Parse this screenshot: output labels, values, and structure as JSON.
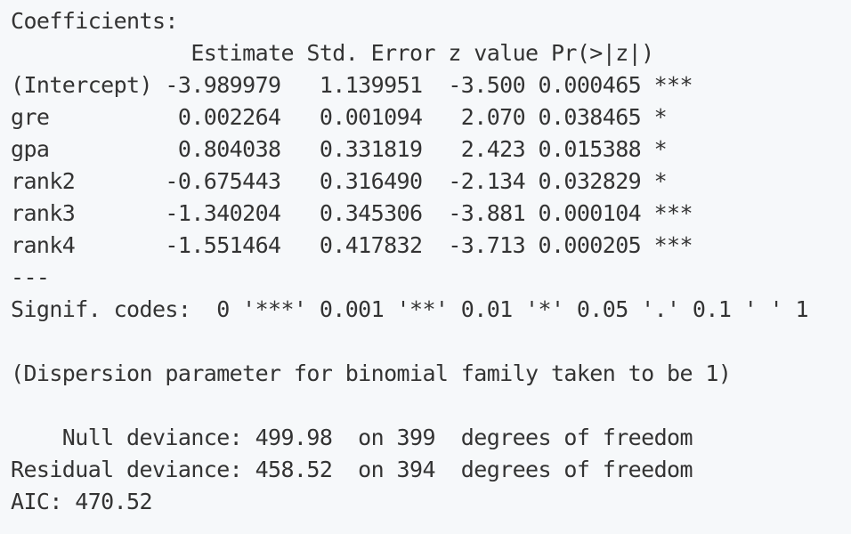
{
  "output": {
    "coef_title": "Coefficients:",
    "coef_header": "              Estimate Std. Error z value Pr(>|z|)    ",
    "rows": [
      "(Intercept) -3.989979   1.139951  -3.500 0.000465 ***",
      "gre          0.002264   0.001094   2.070 0.038465 *  ",
      "gpa          0.804038   0.331819   2.423 0.015388 *  ",
      "rank2       -0.675443   0.316490  -2.134 0.032829 *  ",
      "rank3       -1.340204   0.345306  -3.881 0.000104 ***",
      "rank4       -1.551464   0.417832  -3.713 0.000205 ***"
    ],
    "separator": "---",
    "signif_codes": "Signif. codes:  0 '***' 0.001 '**' 0.01 '*' 0.05 '.' 0.1 ' ' 1",
    "dispersion": "(Dispersion parameter for binomial family taken to be 1)",
    "null_deviance": "    Null deviance: 499.98  on 399  degrees of freedom",
    "residual_deviance": "Residual deviance: 458.52  on 394  degrees of freedom",
    "aic": "AIC: 470.52"
  }
}
